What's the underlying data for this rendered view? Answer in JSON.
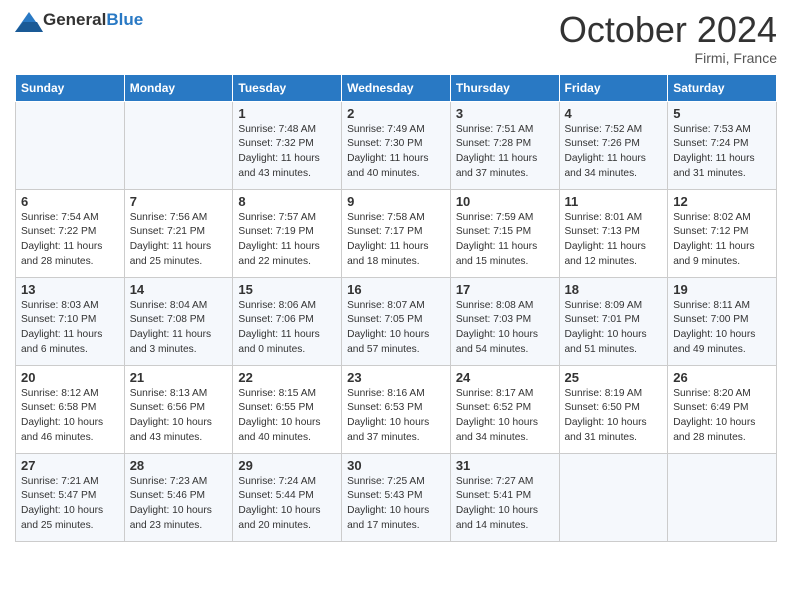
{
  "header": {
    "logo_general": "General",
    "logo_blue": "Blue",
    "month_title": "October 2024",
    "location": "Firmi, France"
  },
  "days_of_week": [
    "Sunday",
    "Monday",
    "Tuesday",
    "Wednesday",
    "Thursday",
    "Friday",
    "Saturday"
  ],
  "weeks": [
    [
      {
        "day": "",
        "info": ""
      },
      {
        "day": "",
        "info": ""
      },
      {
        "day": "1",
        "info": "Sunrise: 7:48 AM\nSunset: 7:32 PM\nDaylight: 11 hours and 43 minutes."
      },
      {
        "day": "2",
        "info": "Sunrise: 7:49 AM\nSunset: 7:30 PM\nDaylight: 11 hours and 40 minutes."
      },
      {
        "day": "3",
        "info": "Sunrise: 7:51 AM\nSunset: 7:28 PM\nDaylight: 11 hours and 37 minutes."
      },
      {
        "day": "4",
        "info": "Sunrise: 7:52 AM\nSunset: 7:26 PM\nDaylight: 11 hours and 34 minutes."
      },
      {
        "day": "5",
        "info": "Sunrise: 7:53 AM\nSunset: 7:24 PM\nDaylight: 11 hours and 31 minutes."
      }
    ],
    [
      {
        "day": "6",
        "info": "Sunrise: 7:54 AM\nSunset: 7:22 PM\nDaylight: 11 hours and 28 minutes."
      },
      {
        "day": "7",
        "info": "Sunrise: 7:56 AM\nSunset: 7:21 PM\nDaylight: 11 hours and 25 minutes."
      },
      {
        "day": "8",
        "info": "Sunrise: 7:57 AM\nSunset: 7:19 PM\nDaylight: 11 hours and 22 minutes."
      },
      {
        "day": "9",
        "info": "Sunrise: 7:58 AM\nSunset: 7:17 PM\nDaylight: 11 hours and 18 minutes."
      },
      {
        "day": "10",
        "info": "Sunrise: 7:59 AM\nSunset: 7:15 PM\nDaylight: 11 hours and 15 minutes."
      },
      {
        "day": "11",
        "info": "Sunrise: 8:01 AM\nSunset: 7:13 PM\nDaylight: 11 hours and 12 minutes."
      },
      {
        "day": "12",
        "info": "Sunrise: 8:02 AM\nSunset: 7:12 PM\nDaylight: 11 hours and 9 minutes."
      }
    ],
    [
      {
        "day": "13",
        "info": "Sunrise: 8:03 AM\nSunset: 7:10 PM\nDaylight: 11 hours and 6 minutes."
      },
      {
        "day": "14",
        "info": "Sunrise: 8:04 AM\nSunset: 7:08 PM\nDaylight: 11 hours and 3 minutes."
      },
      {
        "day": "15",
        "info": "Sunrise: 8:06 AM\nSunset: 7:06 PM\nDaylight: 11 hours and 0 minutes."
      },
      {
        "day": "16",
        "info": "Sunrise: 8:07 AM\nSunset: 7:05 PM\nDaylight: 10 hours and 57 minutes."
      },
      {
        "day": "17",
        "info": "Sunrise: 8:08 AM\nSunset: 7:03 PM\nDaylight: 10 hours and 54 minutes."
      },
      {
        "day": "18",
        "info": "Sunrise: 8:09 AM\nSunset: 7:01 PM\nDaylight: 10 hours and 51 minutes."
      },
      {
        "day": "19",
        "info": "Sunrise: 8:11 AM\nSunset: 7:00 PM\nDaylight: 10 hours and 49 minutes."
      }
    ],
    [
      {
        "day": "20",
        "info": "Sunrise: 8:12 AM\nSunset: 6:58 PM\nDaylight: 10 hours and 46 minutes."
      },
      {
        "day": "21",
        "info": "Sunrise: 8:13 AM\nSunset: 6:56 PM\nDaylight: 10 hours and 43 minutes."
      },
      {
        "day": "22",
        "info": "Sunrise: 8:15 AM\nSunset: 6:55 PM\nDaylight: 10 hours and 40 minutes."
      },
      {
        "day": "23",
        "info": "Sunrise: 8:16 AM\nSunset: 6:53 PM\nDaylight: 10 hours and 37 minutes."
      },
      {
        "day": "24",
        "info": "Sunrise: 8:17 AM\nSunset: 6:52 PM\nDaylight: 10 hours and 34 minutes."
      },
      {
        "day": "25",
        "info": "Sunrise: 8:19 AM\nSunset: 6:50 PM\nDaylight: 10 hours and 31 minutes."
      },
      {
        "day": "26",
        "info": "Sunrise: 8:20 AM\nSunset: 6:49 PM\nDaylight: 10 hours and 28 minutes."
      }
    ],
    [
      {
        "day": "27",
        "info": "Sunrise: 7:21 AM\nSunset: 5:47 PM\nDaylight: 10 hours and 25 minutes."
      },
      {
        "day": "28",
        "info": "Sunrise: 7:23 AM\nSunset: 5:46 PM\nDaylight: 10 hours and 23 minutes."
      },
      {
        "day": "29",
        "info": "Sunrise: 7:24 AM\nSunset: 5:44 PM\nDaylight: 10 hours and 20 minutes."
      },
      {
        "day": "30",
        "info": "Sunrise: 7:25 AM\nSunset: 5:43 PM\nDaylight: 10 hours and 17 minutes."
      },
      {
        "day": "31",
        "info": "Sunrise: 7:27 AM\nSunset: 5:41 PM\nDaylight: 10 hours and 14 minutes."
      },
      {
        "day": "",
        "info": ""
      },
      {
        "day": "",
        "info": ""
      }
    ]
  ]
}
